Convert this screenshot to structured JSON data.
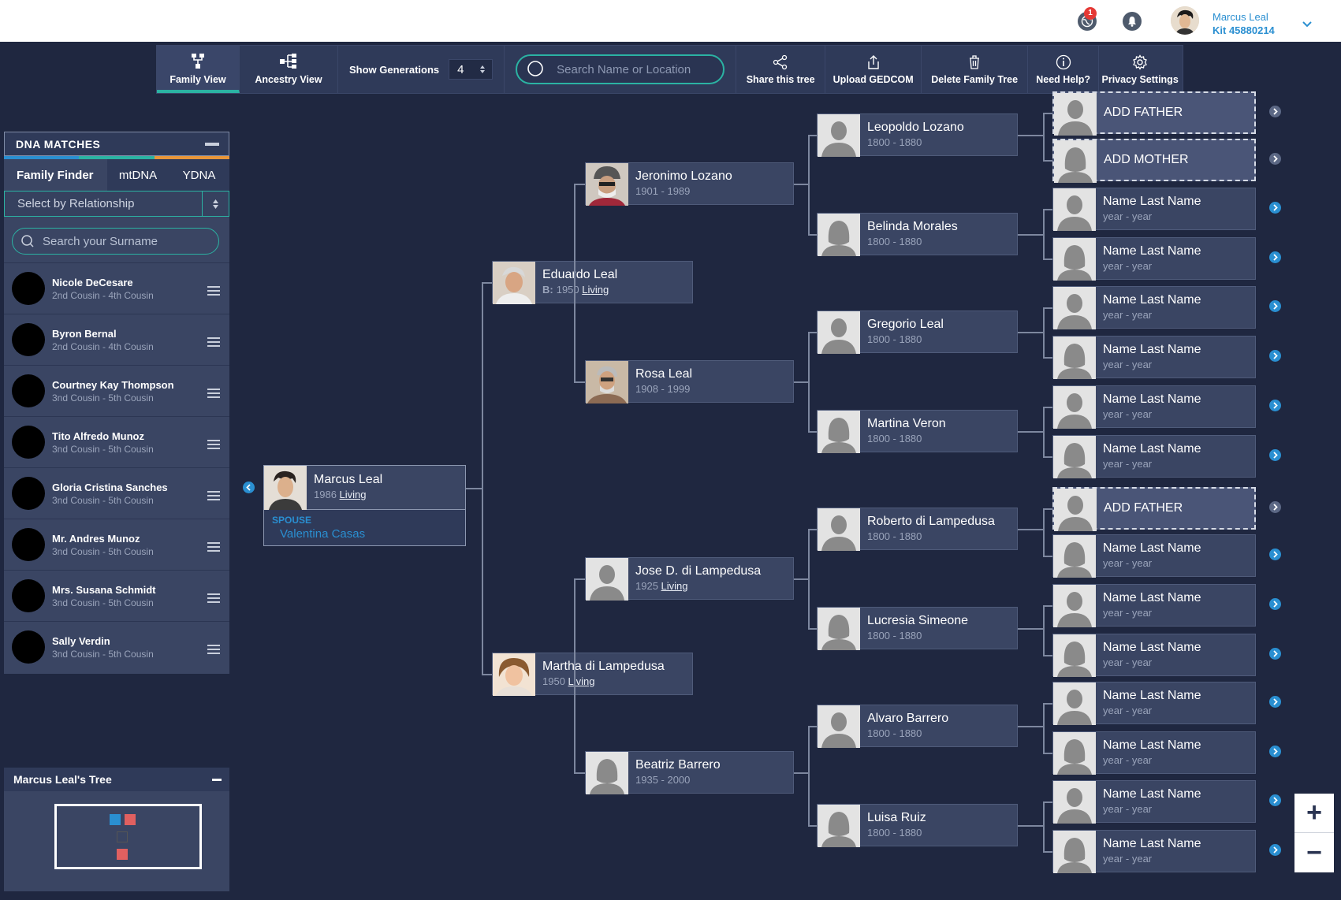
{
  "topbar": {
    "badge_count": "1",
    "user_name": "Marcus Leal",
    "user_kit": "Kit 45880214",
    "icons": [
      "globe-icon",
      "notification-icon",
      "user-avatar",
      "chevron-down-icon"
    ]
  },
  "toolbar": {
    "family_view": "Family View",
    "ancestry_view": "Ancestry View",
    "show_generations": "Show Generations",
    "generations_value": "4",
    "search_placeholder": "Search Name or Location",
    "share": "Share this tree",
    "upload": "Upload GEDCOM",
    "delete": "Delete Family Tree",
    "help": "Need Help?",
    "privacy": "Privacy Settings"
  },
  "dna": {
    "title": "DNA MATCHES",
    "tabs": [
      "Family Finder",
      "mtDNA",
      "YDNA"
    ],
    "tab_colors": [
      "#2a8fd1",
      "#2bb3a3",
      "#e8963a"
    ],
    "relationship_select": "Select by Relationship",
    "surname_placeholder": "Search your Surname",
    "matches": [
      {
        "name": "Nicole DeCesare",
        "rel": "2nd Cousin - 4th Cousin"
      },
      {
        "name": "Byron Bernal",
        "rel": "2nd Cousin - 4th Cousin"
      },
      {
        "name": "Courtney Kay Thompson",
        "rel": "3nd Cousin - 5th Cousin"
      },
      {
        "name": "Tito Alfredo Munoz",
        "rel": "3nd Cousin - 5th Cousin"
      },
      {
        "name": "Gloria Cristina Sanches",
        "rel": "3nd Cousin - 5th Cousin"
      },
      {
        "name": "Mr. Andres Munoz",
        "rel": "3nd Cousin - 5th Cousin"
      },
      {
        "name": "Mrs. Susana Schmidt",
        "rel": "3nd Cousin - 5th Cousin"
      },
      {
        "name": "Sally Verdin",
        "rel": "3nd Cousin - 5th Cousin"
      }
    ]
  },
  "mini_tree": {
    "title": "Marcus Leal's Tree"
  },
  "tree": {
    "root": {
      "name": "Marcus Leal",
      "year": "1986",
      "status": "Living",
      "spouse_label": "SPOUSE",
      "spouse": "Valentina Casas"
    },
    "gen1": [
      {
        "name": "Eduardo Leal",
        "prefix": "B:",
        "year": "1950",
        "status": "Living"
      },
      {
        "name": "Martha di Lampedusa",
        "prefix": "",
        "year": "1950",
        "status": "Living"
      }
    ],
    "gen2": [
      {
        "name": "Jeronimo Lozano",
        "years": "1901 - 1989"
      },
      {
        "name": "Rosa Leal",
        "years": "1908 - 1999"
      },
      {
        "name": "Jose D. di Lampedusa",
        "year": "1925",
        "status": "Living"
      },
      {
        "name": "Beatriz Barrero",
        "years": "1935 - 2000"
      }
    ],
    "gen3": [
      {
        "name": "Leopoldo Lozano",
        "years": "1800 -  1880"
      },
      {
        "name": "Belinda Morales",
        "years": "1800 -  1880"
      },
      {
        "name": "Gregorio Leal",
        "years": "1800 -  1880"
      },
      {
        "name": "Martina Veron",
        "years": "1800 -  1880"
      },
      {
        "name": "Roberto di Lampedusa",
        "years": "1800 -  1880"
      },
      {
        "name": "Lucresia Simeone",
        "years": "1800 -  1880"
      },
      {
        "name": "Alvaro Barrero",
        "years": "1800 -  1880"
      },
      {
        "name": "Luisa Ruiz",
        "years": "1800 -  1880"
      }
    ],
    "gen4": [
      {
        "name": "ADD FATHER",
        "years": "",
        "add": true
      },
      {
        "name": "ADD MOTHER",
        "years": "",
        "add": true
      },
      {
        "name": "Name Last Name",
        "years": "year - year"
      },
      {
        "name": "Name Last Name",
        "years": "year - year"
      },
      {
        "name": "Name Last Name",
        "years": "year - year"
      },
      {
        "name": "Name Last Name",
        "years": "year - year"
      },
      {
        "name": "Name Last Name",
        "years": "year - year"
      },
      {
        "name": "Name Last Name",
        "years": "year - year"
      },
      {
        "name": "ADD FATHER",
        "years": "",
        "add": true
      },
      {
        "name": "Name Last Name",
        "years": "year - year"
      },
      {
        "name": "Name Last Name",
        "years": "year - year"
      },
      {
        "name": "Name Last Name",
        "years": "year - year"
      },
      {
        "name": "Name Last Name",
        "years": "year - year"
      },
      {
        "name": "Name Last Name",
        "years": "year - year"
      },
      {
        "name": "Name Last Name",
        "years": "year - year"
      },
      {
        "name": "Name Last Name",
        "years": "year - year"
      }
    ]
  },
  "zoom": {
    "plus": "+",
    "minus": "−"
  },
  "colors": {
    "accent": "#2bb3a3",
    "link": "#2a8fd1",
    "background": "#1f2740",
    "card": "#3a4563"
  }
}
